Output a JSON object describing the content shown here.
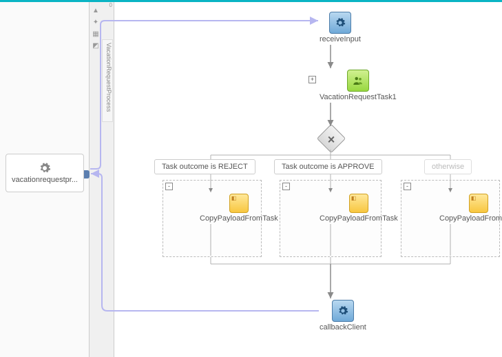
{
  "domain": "Diagram",
  "sidebar": {
    "process_label": "vacationrequestpr...",
    "vertical_tab": "VacationRequestProcess"
  },
  "ruler": {
    "tick0": "0"
  },
  "nodes": {
    "receive": {
      "label": "receiveInput",
      "icon": "gear-icon"
    },
    "human_task": {
      "label": "VacationRequestTask1",
      "icon": "user-task-icon",
      "expand": "+"
    },
    "gateway": {
      "type": "exclusive",
      "mark": "×"
    },
    "callback": {
      "label": "callbackClient",
      "icon": "gear-icon"
    }
  },
  "branches": [
    {
      "label": "Task outcome is REJECT",
      "toggle": "-",
      "activity_label": "CopyPayloadFromTask"
    },
    {
      "label": "Task outcome is APPROVE",
      "toggle": "-",
      "activity_label": "CopyPayloadFromTask"
    },
    {
      "label": "otherwise",
      "toggle": "-",
      "activity_label": "CopyPayloadFromTask",
      "dim": true
    }
  ],
  "colors": {
    "accent_teal": "#0ab4c4",
    "flow_link_lavender": "#b6b6f0",
    "node_blue": "#6fa9d8",
    "node_green": "#98d840",
    "node_yellow": "#f8c740"
  }
}
